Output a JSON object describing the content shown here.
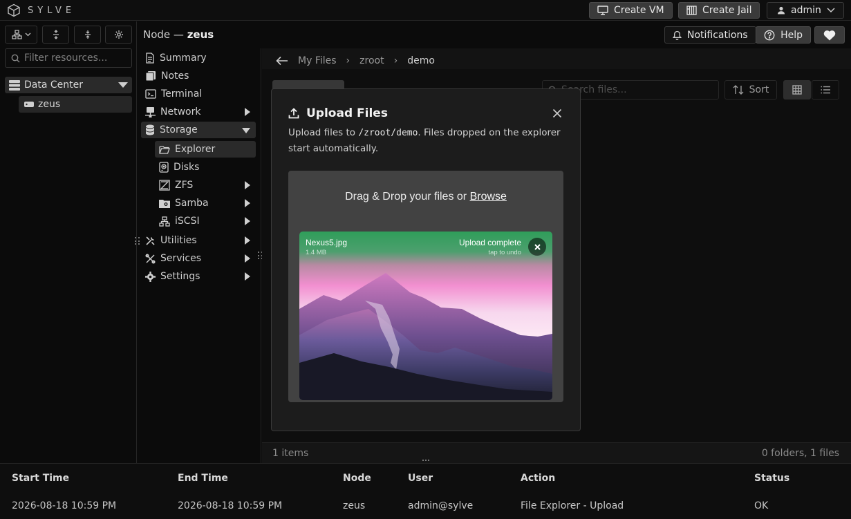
{
  "app": {
    "name": "SYLVE"
  },
  "topbar": {
    "create_vm": "Create VM",
    "create_jail": "Create Jail",
    "user": "admin"
  },
  "left": {
    "filter_placeholder": "Filter resources...",
    "tree": {
      "datacenter": "Data Center",
      "node": "zeus"
    }
  },
  "header": {
    "node_prefix": "Node —",
    "node_name": "zeus",
    "notifications": "Notifications",
    "help": "Help"
  },
  "nav": {
    "summary": "Summary",
    "notes": "Notes",
    "terminal": "Terminal",
    "network": "Network",
    "storage": "Storage",
    "explorer": "Explorer",
    "disks": "Disks",
    "zfs": "ZFS",
    "samba": "Samba",
    "iscsi": "iSCSI",
    "utilities": "Utilities",
    "services": "Services",
    "settings": "Settings"
  },
  "explorer": {
    "crumbs": [
      "My Files",
      "zroot",
      "demo"
    ],
    "search_placeholder": "Search files...",
    "sort": "Sort",
    "items_count": "1 items",
    "summary": "0 folders, 1 files"
  },
  "modal": {
    "title": "Upload Files",
    "desc_prefix": "Upload files to ",
    "desc_path": "/zroot/demo",
    "desc_suffix": ". Files dropped on the explorer start automatically.",
    "drop_text": "Drag & Drop your files or ",
    "browse": "Browse",
    "file": {
      "name": "Nexus5.jpg",
      "size": "1.4 MB",
      "status": "Upload complete",
      "undo": "tap to undo"
    }
  },
  "log": {
    "headers": {
      "start": "Start Time",
      "end": "End Time",
      "node": "Node",
      "user": "User",
      "action": "Action",
      "status": "Status"
    },
    "row": {
      "start": "2026-08-18 10:59 PM",
      "end": "2026-08-18 10:59 PM",
      "node": "zeus",
      "user": "admin@sylve",
      "action": "File Explorer - Upload",
      "status": "OK"
    }
  },
  "colors": {
    "upload_complete": "#3fa868",
    "background": "#0b0b0b",
    "modal": "#1c1c1c"
  }
}
